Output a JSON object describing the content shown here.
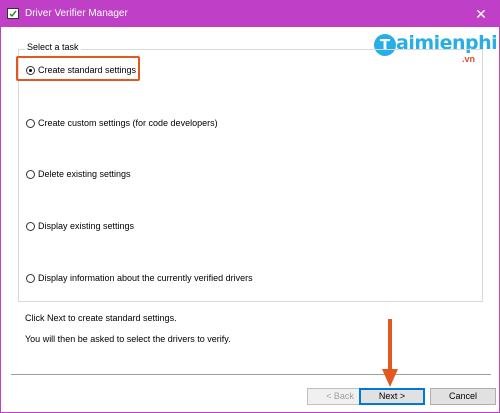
{
  "window": {
    "title": "Driver Verifier Manager",
    "close_glyph": "✕",
    "titlebar_color": "#c03fc7"
  },
  "logo": {
    "mark": "T",
    "name": "aimienphi",
    "suffix": ".vn",
    "color": "#27aee7",
    "suffix_color": "#e54a2d"
  },
  "task_group": {
    "label": "Select a task",
    "options": [
      {
        "label": "Create standard settings",
        "selected": true
      },
      {
        "label": "Create custom settings (for code developers)",
        "selected": false
      },
      {
        "label": "Delete existing settings",
        "selected": false
      },
      {
        "label": "Display existing settings",
        "selected": false
      },
      {
        "label": "Display information about the currently verified drivers",
        "selected": false
      }
    ]
  },
  "hints": {
    "line1": "Click Next to create standard settings.",
    "line2": "You will then be asked to select the drivers to verify."
  },
  "buttons": {
    "back": "< Back",
    "next": "Next >",
    "cancel": "Cancel"
  },
  "annotation_color": "#e2591f"
}
